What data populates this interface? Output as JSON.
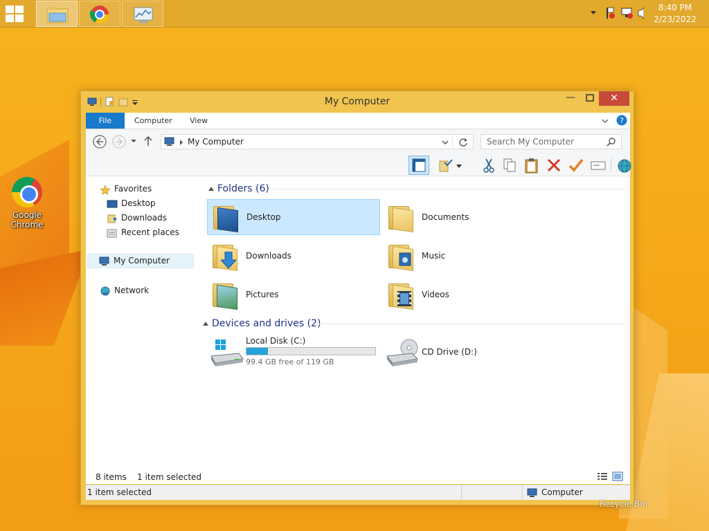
{
  "taskbar": {
    "clock_time": "8:40 PM",
    "clock_date": "2/23/2022"
  },
  "desktop": {
    "icon_label_line1": "Google",
    "icon_label_line2": "Chrome"
  },
  "window": {
    "title": "My Computer",
    "close_glyph": "✕",
    "min_glyph": "—",
    "tabs": [
      {
        "label": "File"
      },
      {
        "label": "Computer"
      },
      {
        "label": "View"
      }
    ],
    "address": "My Computer",
    "search_placeholder": "Search My Computer",
    "nav": {
      "favorites": "Favorites",
      "desktop": "Desktop",
      "downloads": "Downloads",
      "recent": "Recent places",
      "computer": "My Computer",
      "network": "Network"
    },
    "folders_header": "Folders (6)",
    "folders": [
      {
        "label": "Desktop"
      },
      {
        "label": "Documents"
      },
      {
        "label": "Downloads"
      },
      {
        "label": "Music"
      },
      {
        "label": "Pictures"
      },
      {
        "label": "Videos"
      }
    ],
    "drives_header": "Devices and drives (2)",
    "drives": [
      {
        "label": "Local Disk (C:)",
        "free_text": "99.4 GB free of 119 GB",
        "used_fraction": 0.165
      },
      {
        "label": "CD Drive (D:)"
      }
    ],
    "status": {
      "items": "8 items",
      "selected": "1 item selected",
      "bottom_selected": "1 item selected",
      "location": "Computer"
    }
  },
  "watermark": "Recycle Bin",
  "colors": {
    "accent": "#1979ca",
    "selection": "#cce8ff",
    "close": "#c7493a",
    "drive_fill": "#26a0da"
  }
}
